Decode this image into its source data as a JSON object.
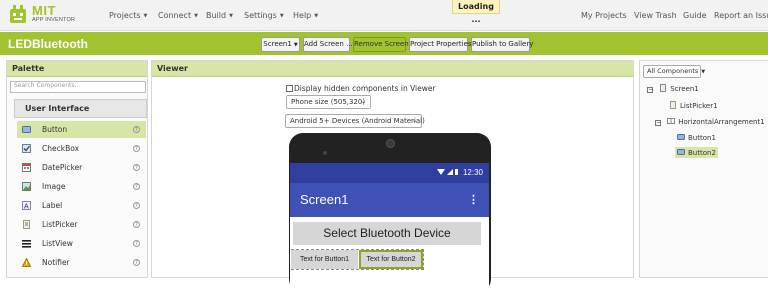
{
  "header": {
    "logo_title": "MIT",
    "logo_subtitle": "APP INVENTOR",
    "menus": [
      "Projects",
      "Connect",
      "Build",
      "Settings",
      "Help"
    ],
    "loading_text": "Loading ...",
    "right_links": [
      "My Projects",
      "View Trash",
      "Guide",
      "Report an Issue"
    ]
  },
  "project_bar": {
    "project_name": "LEDBluetooth",
    "screen_select": "Screen1",
    "add_screen": "Add Screen ...",
    "remove_screen": "Remove Screen",
    "project_properties": "Project Properties",
    "publish": "Publish to Gallery"
  },
  "palette": {
    "title": "Palette",
    "search_placeholder": "Search Components...",
    "category": "User Interface",
    "items": [
      {
        "label": "Button",
        "icon": "button-icon",
        "selected": true
      },
      {
        "label": "CheckBox",
        "icon": "checkbox-icon",
        "selected": false
      },
      {
        "label": "DatePicker",
        "icon": "datepicker-icon",
        "selected": false
      },
      {
        "label": "Image",
        "icon": "image-icon",
        "selected": false
      },
      {
        "label": "Label",
        "icon": "label-icon",
        "selected": false
      },
      {
        "label": "ListPicker",
        "icon": "listpicker-icon",
        "selected": false
      },
      {
        "label": "ListView",
        "icon": "listview-icon",
        "selected": false
      },
      {
        "label": "Notifier",
        "icon": "notifier-icon",
        "selected": false
      }
    ],
    "help_glyph": "?"
  },
  "viewer": {
    "title": "Viewer",
    "hidden_components_label": "Display hidden components in Viewer",
    "phone_size": "Phone size (505,320)",
    "device_theme": "Android 5+ Devices (Android Material)",
    "phone": {
      "time": "12:30",
      "screen_title": "Screen1",
      "menu_glyph": "⋮",
      "listpicker_text": "Select Bluetooth Device",
      "button1_text": "Text for Button1",
      "button2_text": "Text for Button2"
    }
  },
  "components": {
    "dropdown": "All Components",
    "tree": [
      {
        "label": "Screen1",
        "level": 0,
        "toggle": "−"
      },
      {
        "label": "ListPicker1",
        "level": 1
      },
      {
        "label": "HorizontalArrangement1",
        "level": 1,
        "toggle": "−"
      },
      {
        "label": "Button1",
        "level": 2
      },
      {
        "label": "Button2",
        "level": 2,
        "selected": true
      }
    ]
  },
  "colors": {
    "brand_green": "#a2c230",
    "panel_header": "#d7e6a6",
    "status_bar": "#303f9f",
    "app_bar": "#3f51b5"
  }
}
